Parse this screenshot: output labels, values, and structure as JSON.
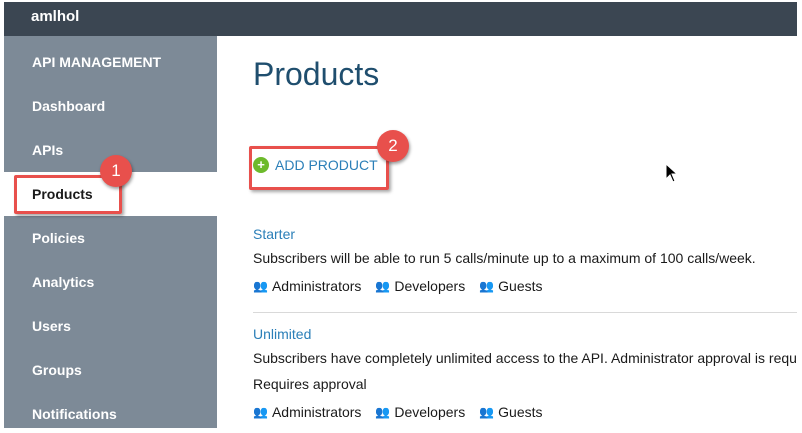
{
  "account": "amlhol",
  "sidebar": {
    "header": "API MANAGEMENT",
    "items": [
      {
        "label": "Dashboard"
      },
      {
        "label": "APIs"
      },
      {
        "label": "Products"
      },
      {
        "label": "Policies"
      },
      {
        "label": "Analytics"
      },
      {
        "label": "Users"
      },
      {
        "label": "Groups"
      },
      {
        "label": "Notifications"
      }
    ],
    "active": "Products"
  },
  "main": {
    "title": "Products",
    "add_product": "ADD PRODUCT",
    "products": [
      {
        "name": "Starter",
        "description": "Subscribers will be able to run 5 calls/minute up to a maximum of 100 calls/week.",
        "groups": [
          "Administrators",
          "Developers",
          "Guests"
        ]
      },
      {
        "name": "Unlimited",
        "description": "Subscribers have completely unlimited access to the API. Administrator approval is requi",
        "requires": "Requires approval",
        "groups": [
          "Administrators",
          "Developers",
          "Guests"
        ]
      }
    ]
  },
  "callouts": [
    "1",
    "2"
  ],
  "colors": {
    "topbar": "#3b4652",
    "sidebar": "#7d8a97",
    "link": "#2b7fb8",
    "title": "#1f4e6e",
    "callout": "#e8504c",
    "add_icon": "#6dba2c"
  }
}
